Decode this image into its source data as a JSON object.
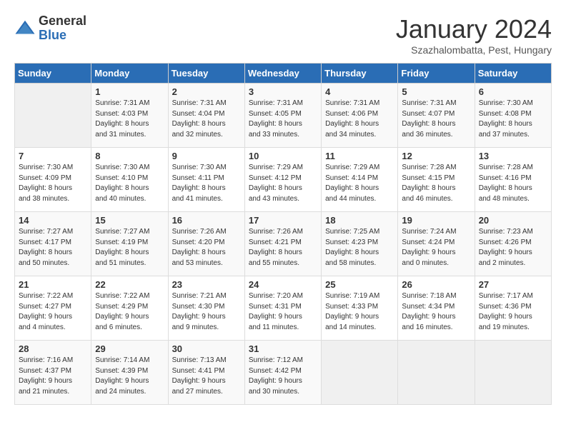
{
  "logo": {
    "general": "General",
    "blue": "Blue"
  },
  "title": "January 2024",
  "location": "Szazhalombatta, Pest, Hungary",
  "weekdays": [
    "Sunday",
    "Monday",
    "Tuesday",
    "Wednesday",
    "Thursday",
    "Friday",
    "Saturday"
  ],
  "weeks": [
    [
      {
        "day": "",
        "info": ""
      },
      {
        "day": "1",
        "info": "Sunrise: 7:31 AM\nSunset: 4:03 PM\nDaylight: 8 hours\nand 31 minutes."
      },
      {
        "day": "2",
        "info": "Sunrise: 7:31 AM\nSunset: 4:04 PM\nDaylight: 8 hours\nand 32 minutes."
      },
      {
        "day": "3",
        "info": "Sunrise: 7:31 AM\nSunset: 4:05 PM\nDaylight: 8 hours\nand 33 minutes."
      },
      {
        "day": "4",
        "info": "Sunrise: 7:31 AM\nSunset: 4:06 PM\nDaylight: 8 hours\nand 34 minutes."
      },
      {
        "day": "5",
        "info": "Sunrise: 7:31 AM\nSunset: 4:07 PM\nDaylight: 8 hours\nand 36 minutes."
      },
      {
        "day": "6",
        "info": "Sunrise: 7:30 AM\nSunset: 4:08 PM\nDaylight: 8 hours\nand 37 minutes."
      }
    ],
    [
      {
        "day": "7",
        "info": "Sunrise: 7:30 AM\nSunset: 4:09 PM\nDaylight: 8 hours\nand 38 minutes."
      },
      {
        "day": "8",
        "info": "Sunrise: 7:30 AM\nSunset: 4:10 PM\nDaylight: 8 hours\nand 40 minutes."
      },
      {
        "day": "9",
        "info": "Sunrise: 7:30 AM\nSunset: 4:11 PM\nDaylight: 8 hours\nand 41 minutes."
      },
      {
        "day": "10",
        "info": "Sunrise: 7:29 AM\nSunset: 4:12 PM\nDaylight: 8 hours\nand 43 minutes."
      },
      {
        "day": "11",
        "info": "Sunrise: 7:29 AM\nSunset: 4:14 PM\nDaylight: 8 hours\nand 44 minutes."
      },
      {
        "day": "12",
        "info": "Sunrise: 7:28 AM\nSunset: 4:15 PM\nDaylight: 8 hours\nand 46 minutes."
      },
      {
        "day": "13",
        "info": "Sunrise: 7:28 AM\nSunset: 4:16 PM\nDaylight: 8 hours\nand 48 minutes."
      }
    ],
    [
      {
        "day": "14",
        "info": "Sunrise: 7:27 AM\nSunset: 4:17 PM\nDaylight: 8 hours\nand 50 minutes."
      },
      {
        "day": "15",
        "info": "Sunrise: 7:27 AM\nSunset: 4:19 PM\nDaylight: 8 hours\nand 51 minutes."
      },
      {
        "day": "16",
        "info": "Sunrise: 7:26 AM\nSunset: 4:20 PM\nDaylight: 8 hours\nand 53 minutes."
      },
      {
        "day": "17",
        "info": "Sunrise: 7:26 AM\nSunset: 4:21 PM\nDaylight: 8 hours\nand 55 minutes."
      },
      {
        "day": "18",
        "info": "Sunrise: 7:25 AM\nSunset: 4:23 PM\nDaylight: 8 hours\nand 58 minutes."
      },
      {
        "day": "19",
        "info": "Sunrise: 7:24 AM\nSunset: 4:24 PM\nDaylight: 9 hours\nand 0 minutes."
      },
      {
        "day": "20",
        "info": "Sunrise: 7:23 AM\nSunset: 4:26 PM\nDaylight: 9 hours\nand 2 minutes."
      }
    ],
    [
      {
        "day": "21",
        "info": "Sunrise: 7:22 AM\nSunset: 4:27 PM\nDaylight: 9 hours\nand 4 minutes."
      },
      {
        "day": "22",
        "info": "Sunrise: 7:22 AM\nSunset: 4:29 PM\nDaylight: 9 hours\nand 6 minutes."
      },
      {
        "day": "23",
        "info": "Sunrise: 7:21 AM\nSunset: 4:30 PM\nDaylight: 9 hours\nand 9 minutes."
      },
      {
        "day": "24",
        "info": "Sunrise: 7:20 AM\nSunset: 4:31 PM\nDaylight: 9 hours\nand 11 minutes."
      },
      {
        "day": "25",
        "info": "Sunrise: 7:19 AM\nSunset: 4:33 PM\nDaylight: 9 hours\nand 14 minutes."
      },
      {
        "day": "26",
        "info": "Sunrise: 7:18 AM\nSunset: 4:34 PM\nDaylight: 9 hours\nand 16 minutes."
      },
      {
        "day": "27",
        "info": "Sunrise: 7:17 AM\nSunset: 4:36 PM\nDaylight: 9 hours\nand 19 minutes."
      }
    ],
    [
      {
        "day": "28",
        "info": "Sunrise: 7:16 AM\nSunset: 4:37 PM\nDaylight: 9 hours\nand 21 minutes."
      },
      {
        "day": "29",
        "info": "Sunrise: 7:14 AM\nSunset: 4:39 PM\nDaylight: 9 hours\nand 24 minutes."
      },
      {
        "day": "30",
        "info": "Sunrise: 7:13 AM\nSunset: 4:41 PM\nDaylight: 9 hours\nand 27 minutes."
      },
      {
        "day": "31",
        "info": "Sunrise: 7:12 AM\nSunset: 4:42 PM\nDaylight: 9 hours\nand 30 minutes."
      },
      {
        "day": "",
        "info": ""
      },
      {
        "day": "",
        "info": ""
      },
      {
        "day": "",
        "info": ""
      }
    ]
  ]
}
